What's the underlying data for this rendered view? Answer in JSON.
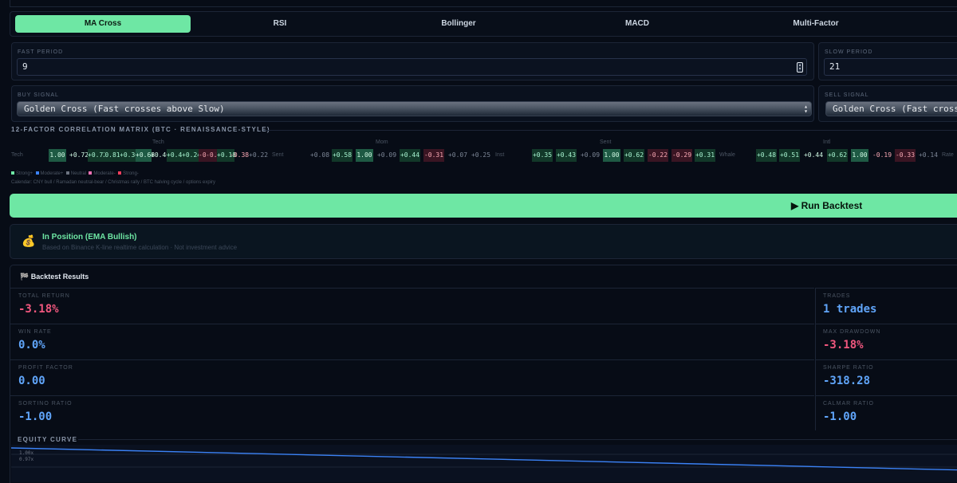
{
  "tabs": [
    {
      "label": "MA Cross",
      "active": true
    },
    {
      "label": "RSI",
      "active": false
    },
    {
      "label": "Bollinger",
      "active": false
    },
    {
      "label": "MACD",
      "active": false
    },
    {
      "label": "Multi-Factor",
      "active": false
    }
  ],
  "fast_period": {
    "label": "FAST PERIOD",
    "value": "9"
  },
  "slow_period": {
    "label": "SLOW PERIOD",
    "value": "21"
  },
  "buy_signal": {
    "label": "BUY SIGNAL",
    "selected": "Golden Cross (Fast crosses above Slow)"
  },
  "sell_signal": {
    "label": "SELL SIGNAL",
    "selected": "Golden Cross (Fast crosses"
  },
  "matrix": {
    "title": "12-FACTOR CORRELATION MATRIX (BTC · RENAISSANCE-STYLE)",
    "groups": [
      "Tech",
      "Mom",
      "Sent",
      "Intl"
    ],
    "rows": [
      {
        "label": "Tech",
        "cells": [
          "1.00",
          "+0.72",
          "+0.72",
          "0.81",
          "+0.36",
          "+0.68",
          "+0.40",
          "+0.43",
          "+0.24",
          "-0.51",
          "-0.08",
          "+0.18",
          "-0.38",
          "+0.22"
        ]
      },
      {
        "label": "Sent",
        "cells": [
          "+0.08",
          "+0.58",
          "1.00",
          "+0.09",
          "+0.44",
          "-0.31",
          "+0.07",
          "+0.25"
        ]
      },
      {
        "label": "Inst",
        "cells": [
          "+0.35",
          "+0.43",
          "+0.09",
          "1.00",
          "+0.62",
          "-0.22",
          "-0.29",
          "+0.31"
        ]
      },
      {
        "label": "Whale",
        "cells": [
          "+0.48",
          "+0.51",
          "+0.44",
          "+0.62",
          "1.00",
          "-0.19",
          "-0.33",
          "+0.14"
        ]
      },
      {
        "label": "Rate",
        "cells": []
      }
    ],
    "legend": [
      "Strong+",
      "Moderate+",
      "Neutral",
      "Moderate-",
      "Strong-"
    ],
    "legend_colors": [
      "#6ee7a4",
      "#3b82f6",
      "#6b7280",
      "#f472b6",
      "#f43f5e"
    ],
    "note": "Calendar: CNY bull / Ramadan neutral-bear / Christmas rally / BTC halving cycle / options expiry"
  },
  "run_button": {
    "label": "▶ Run Backtest"
  },
  "status": {
    "icon": "money-bag-icon",
    "glyph": "💰",
    "title": "In Position (EMA Bullish)",
    "subtitle": "Based on Binance K-line realtime calculation · Not investment advice"
  },
  "results": {
    "title": "🏁 Backtest Results",
    "metrics": [
      {
        "label": "TOTAL RETURN",
        "value": "-3.18%",
        "tone": "neg"
      },
      {
        "label": "TRADES",
        "value": "1 trades",
        "tone": "pos"
      },
      {
        "label": "WIN RATE",
        "value": "0.0%",
        "tone": "pos"
      },
      {
        "label": "MAX DRAWDOWN",
        "value": "-3.18%",
        "tone": "neg"
      },
      {
        "label": "PROFIT FACTOR",
        "value": "0.00",
        "tone": "pos"
      },
      {
        "label": "SHARPE RATIO",
        "value": "-318.28",
        "tone": "pos"
      },
      {
        "label": "SORTINO RATIO",
        "value": "-1.00",
        "tone": "pos"
      },
      {
        "label": "CALMAR RATIO",
        "value": "-1.00",
        "tone": "pos"
      }
    ]
  },
  "equity": {
    "title": "EQUITY CURVE",
    "ticks": [
      "1.00x",
      "0.97x"
    ],
    "chart_data": {
      "type": "line",
      "series": [
        {
          "values": [
            1.0,
            0.9682
          ]
        }
      ],
      "ylim": [
        0.97,
        1.0
      ]
    }
  }
}
